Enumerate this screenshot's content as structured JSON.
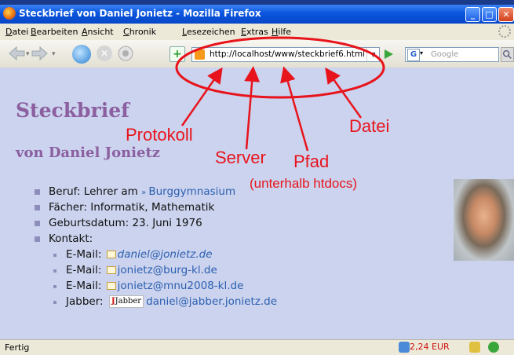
{
  "window": {
    "title": "Steckbrief von Daniel Jonietz - Mozilla Firefox"
  },
  "menu": [
    {
      "label": "Datei",
      "key": "D"
    },
    {
      "label": "Bearbeiten",
      "key": "B"
    },
    {
      "label": "Ansicht",
      "key": "A"
    },
    {
      "label": "Chronik",
      "key": "C"
    },
    {
      "label": "Lesezeichen",
      "key": "L"
    },
    {
      "label": "Extras",
      "key": "E"
    },
    {
      "label": "Hilfe",
      "key": "H"
    }
  ],
  "navbar": {
    "url": "http://localhost/www/steckbrief6.html",
    "search_engine": "G",
    "search_placeholder": "Google"
  },
  "page": {
    "title": "Steckbrief",
    "subtitle": "von Daniel Jonietz",
    "beruf_label": "Beruf: Lehrer am",
    "beruf_link": "Burggymnasium",
    "faecher": "Fächer: Informatik, Mathematik",
    "geburtsdatum": "Geburtsdatum: 23. Juni 1976",
    "kontakt": "Kontakt:",
    "contacts": [
      {
        "label": "E-Mail:",
        "value": "daniel@jonietz.de"
      },
      {
        "label": "E-Mail:",
        "value": "jonietz@burg-kl.de"
      },
      {
        "label": "E-Mail:",
        "value": "jonietz@mnu2008-kl.de"
      },
      {
        "label": "Jabber:",
        "value": "daniel@jabber.jonietz.de",
        "badge": "Jabber"
      }
    ]
  },
  "annotations": {
    "protokoll": "Protokoll",
    "server": "Server",
    "pfad": "Pfad",
    "pfad_note": "(unterhalb htdocs)",
    "datei": "Datei"
  },
  "colors": {
    "annotation": "#e8141c",
    "heading": "#8b5fa0",
    "background": "#cbd3ee",
    "link": "#2c5fb0"
  },
  "statusbar": {
    "text": "Fertig",
    "price": "2,24 EUR"
  }
}
